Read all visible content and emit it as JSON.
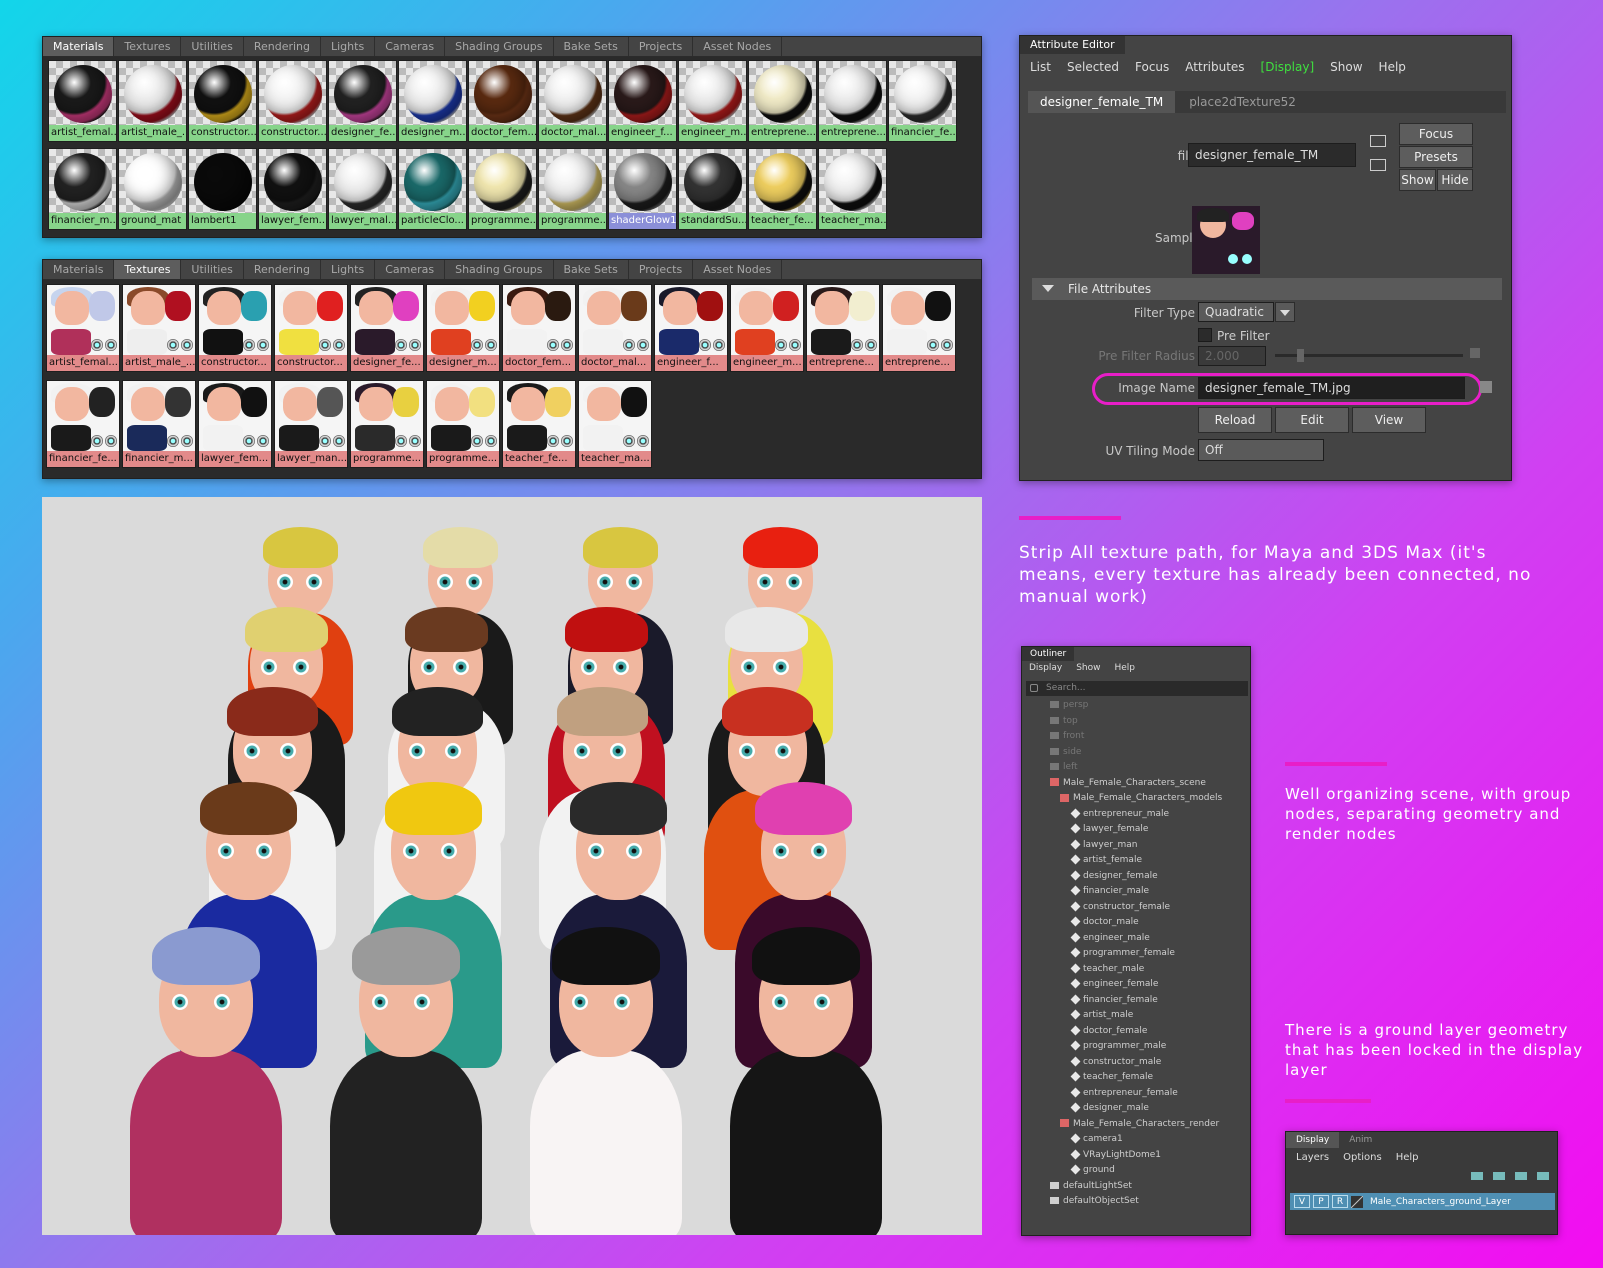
{
  "hypershade1": {
    "tabs": [
      "Materials",
      "Textures",
      "Utilities",
      "Rendering",
      "Lights",
      "Cameras",
      "Shading Groups",
      "Bake Sets",
      "Projects",
      "Asset Nodes"
    ],
    "active": "Materials",
    "items": [
      {
        "label": "artist_femal...",
        "c1": "#1a1a1a",
        "c2": "#e0408a"
      },
      {
        "label": "artist_male_...",
        "c1": "#eeeeee",
        "c2": "#b01020"
      },
      {
        "label": "constructor...",
        "c1": "#111111",
        "c2": "#f2c020"
      },
      {
        "label": "constructor...",
        "c1": "#f4f4f4",
        "c2": "#cc2222"
      },
      {
        "label": "designer_fe...",
        "c1": "#222222",
        "c2": "#e04cb0"
      },
      {
        "label": "designer_m...",
        "c1": "#f0f0f0",
        "c2": "#2040c0"
      },
      {
        "label": "doctor_fem...",
        "c1": "#5a2a10",
        "c2": "#7a3a1a"
      },
      {
        "label": "doctor_mal...",
        "c1": "#f2f2f2",
        "c2": "#6a3a1a"
      },
      {
        "label": "engineer_f...",
        "c1": "#2a1a1a",
        "c2": "#c02020"
      },
      {
        "label": "engineer_m...",
        "c1": "#eeeeee",
        "c2": "#cc2020"
      },
      {
        "label": "entreprene...",
        "c1": "#f2ecc8",
        "c2": "#111111"
      },
      {
        "label": "entreprene...",
        "c1": "#eeeeee",
        "c2": "#111111"
      },
      {
        "label": "financier_fe...",
        "c1": "#f4f4f4",
        "c2": "#333333"
      },
      {
        "label": "financier_m...",
        "c1": "#222222",
        "c2": "#eeeeee"
      },
      {
        "label": "ground_mat",
        "c1": "#ffffff",
        "c2": "#cccccc"
      },
      {
        "label": "lambert1",
        "c1": "#0a0a0a",
        "c2": "#0a0a0a",
        "solid": true
      },
      {
        "label": "lawyer_fem...",
        "c1": "#111111",
        "c2": "#222222"
      },
      {
        "label": "lawyer_mal...",
        "c1": "#f0f0f0",
        "c2": "#333333"
      },
      {
        "label": "particleClo...",
        "c1": "#1a6a6a",
        "c2": "#3cc0d0"
      },
      {
        "label": "programme...",
        "c1": "#f2e8b0",
        "c2": "#222222"
      },
      {
        "label": "programme...",
        "c1": "#f2f2f2",
        "c2": "#e8d070"
      },
      {
        "label": "shaderGlow1",
        "c1": "#888888",
        "c2": "#222222",
        "sel": true
      },
      {
        "label": "standardSu...",
        "c1": "#333333",
        "c2": "#1c1c1c"
      },
      {
        "label": "teacher_fe...",
        "c1": "#f0d060",
        "c2": "#111111"
      },
      {
        "label": "teacher_ma...",
        "c1": "#f2f2f2",
        "c2": "#111111"
      }
    ]
  },
  "hypershade2": {
    "tabs": [
      "Materials",
      "Textures",
      "Utilities",
      "Rendering",
      "Lights",
      "Cameras",
      "Shading Groups",
      "Bake Sets",
      "Projects",
      "Asset Nodes"
    ],
    "active": "Textures",
    "items": [
      {
        "label": "artist_femal...",
        "hair": "#c6d4ee",
        "body": "#b0305a",
        "blk": "#c0c8e8"
      },
      {
        "label": "artist_male_...",
        "hair": "#8a4a2a",
        "body": "#eeeeee",
        "blk": "#b01020"
      },
      {
        "label": "constructor...",
        "hair": "#222222",
        "body": "#111111",
        "blk": "#2aa0b0"
      },
      {
        "label": "constructor...",
        "hair": "#f2f2f2",
        "body": "#f0e040",
        "blk": "#e02020"
      },
      {
        "label": "designer_fe...",
        "hair": "#222222",
        "body": "#2a1a2a",
        "blk": "#e040c0"
      },
      {
        "label": "designer_m...",
        "hair": "#f2f2f2",
        "body": "#e04020",
        "blk": "#f2d020"
      },
      {
        "label": "doctor_fem...",
        "hair": "#3a1a10",
        "body": "#f2f2f2",
        "blk": "#2a1a10"
      },
      {
        "label": "doctor_mal...",
        "hair": "#f2f2f2",
        "body": "#f2f2f2",
        "blk": "#6a3a1a"
      },
      {
        "label": "engineer_f...",
        "hair": "#1a1a2a",
        "body": "#1a2a6a",
        "blk": "#a01010"
      },
      {
        "label": "engineer_m...",
        "hair": "#f2f2f2",
        "body": "#e04020",
        "blk": "#d02020"
      },
      {
        "label": "entreprene...",
        "hair": "#2a1a1a",
        "body": "#1a1a1a",
        "blk": "#f2eed0"
      },
      {
        "label": "entreprene...",
        "hair": "#f2f2f2",
        "body": "#f2f2f2",
        "blk": "#111111"
      },
      {
        "label": "financier_fe...",
        "hair": "#f2f2f2",
        "body": "#1a1a1a",
        "blk": "#222222"
      },
      {
        "label": "financier_m...",
        "hair": "#f2f2f2",
        "body": "#1a2a5a",
        "blk": "#333333"
      },
      {
        "label": "lawyer_fem...",
        "hair": "#1a1a1a",
        "body": "#f2f2f2",
        "blk": "#111111"
      },
      {
        "label": "lawyer_man...",
        "hair": "#f2f2f2",
        "body": "#1a1a1a",
        "blk": "#555555"
      },
      {
        "label": "programme...",
        "hair": "#2a1a2a",
        "body": "#2a2a2a",
        "blk": "#e8d040"
      },
      {
        "label": "programme...",
        "hair": "#f2f2f2",
        "body": "#1a1a1a",
        "blk": "#f2e080"
      },
      {
        "label": "teacher_fe...",
        "hair": "#1a1a1a",
        "body": "#1a1a1a",
        "blk": "#f0d060"
      },
      {
        "label": "teacher_ma...",
        "hair": "#f2f2f2",
        "body": "#f2f2f2",
        "blk": "#111111"
      }
    ]
  },
  "attr": {
    "title": "Attribute Editor",
    "menu": [
      "List",
      "Selected",
      "Focus",
      "Attributes",
      "[Display]",
      "Show",
      "Help"
    ],
    "tabs": [
      "designer_female_TM",
      "place2dTexture52"
    ],
    "file_label": "file:",
    "file_value": "designer_female_TM",
    "focus": "Focus",
    "presets": "Presets",
    "show": "Show",
    "hide": "Hide",
    "sample_label": "Sample",
    "section": "File Attributes",
    "filter_type_label": "Filter Type",
    "filter_type": "Quadratic",
    "pre_filter": "Pre Filter",
    "pre_filter_radius_label": "Pre Filter Radius",
    "pre_filter_radius": "2.000",
    "image_name_label": "Image Name",
    "image_name": "designer_female_TM.jpg",
    "reload": "Reload",
    "edit": "Edit",
    "view": "View",
    "uv_label": "UV Tiling Mode",
    "uv_value": "Off"
  },
  "notes": {
    "strip": "Strip All texture path, for Maya and 3DS Max (it's means, every texture has already been connected, no manual work)",
    "organize": "Well organizing scene, with group nodes, separating geometry and render nodes",
    "ground": "There is a ground layer geometry that has been locked in the display layer"
  },
  "outliner": {
    "title": "Outliner",
    "menu": [
      "Display",
      "Show",
      "Help"
    ],
    "search": "Search...",
    "cams": [
      "persp",
      "top",
      "front",
      "side",
      "left"
    ],
    "scene": "Male_Female_Characters_scene",
    "models": "Male_Female_Characters_models",
    "chars": [
      "entrepreneur_male",
      "lawyer_female",
      "lawyer_man",
      "artist_female",
      "designer_female",
      "financier_male",
      "constructor_female",
      "doctor_male",
      "engineer_male",
      "programmer_female",
      "teacher_male",
      "engineer_female",
      "financier_female",
      "artist_male",
      "doctor_female",
      "programmer_male",
      "constructor_male",
      "teacher_female",
      "entrepreneur_female",
      "designer_male"
    ],
    "render": "Male_Female_Characters_render",
    "render_items": [
      "camera1",
      "VRayLightDome1",
      "ground"
    ],
    "sets": [
      "defaultLightSet",
      "defaultObjectSet"
    ]
  },
  "layers": {
    "tabs": [
      "Display",
      "Anim"
    ],
    "menu": [
      "Layers",
      "Options",
      "Help"
    ],
    "flags": [
      "V",
      "P",
      "R"
    ],
    "layer": "Male_Characters_ground_Layer"
  },
  "viewport": {
    "characters": [
      {
        "hair": "#d8c640",
        "torso": "#e04010"
      },
      {
        "hair": "#e4dca8",
        "torso": "#1a1a1a"
      },
      {
        "hair": "#d8c640",
        "torso": "#1a1a2a"
      },
      {
        "hair": "#e82010",
        "torso": "#e8e040"
      },
      {
        "hair": "#e0d070",
        "torso": "#1a1a1a"
      },
      {
        "hair": "#6a3a20",
        "torso": "#f2f2f2"
      },
      {
        "hair": "#c01010",
        "torso": "#c01020"
      },
      {
        "hair": "#e8e8e8",
        "torso": "#1a1a1a"
      },
      {
        "hair": "#8a2a1a",
        "torso": "#f2f2f2"
      },
      {
        "hair": "#222222",
        "torso": "#f2f2f2"
      },
      {
        "hair": "#c0a080",
        "torso": "#f2f2f2"
      },
      {
        "hair": "#c83020",
        "torso": "#e05010"
      },
      {
        "hair": "#6a3a1a",
        "torso": "#1a2aa0"
      },
      {
        "hair": "#f0c810",
        "torso": "#2a9a8a"
      },
      {
        "hair": "#2a2a2a",
        "torso": "#1a1a3a"
      },
      {
        "hair": "#e040b0",
        "torso": "#3a0a2a"
      },
      {
        "hair": "#8a9ad0",
        "torso": "#b03060"
      },
      {
        "hair": "#9a9a9a",
        "torso": "#222222"
      },
      {
        "hair": "#111111",
        "torso": "#f8f4f4"
      },
      {
        "hair": "#111111",
        "torso": "#151515"
      }
    ]
  }
}
